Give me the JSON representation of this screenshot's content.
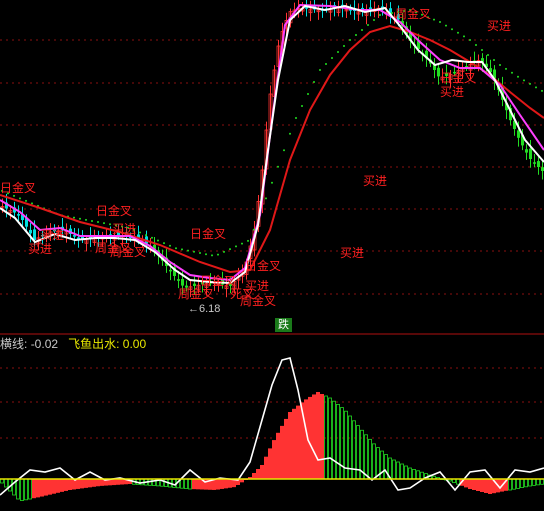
{
  "indicator": {
    "line_label": "横线:",
    "line_value": "-0.02",
    "flow_label": "飞鱼出水:",
    "flow_value": "0.00"
  },
  "badge_text": "跌",
  "colors": {
    "up": "#ff3333",
    "down": "#00e0e0",
    "down_strong": "#22dd22",
    "ma_white": "#ffffff",
    "ma_magenta": "#ff40ff",
    "ma_red": "#e01818",
    "dots_green": "#20e020",
    "grid_red": "#8a1010",
    "label_red": "#ff2020",
    "yellow": "#e8e800"
  },
  "chart_data": [
    {
      "type": "candlestick",
      "title": "",
      "grid": true,
      "price_markers": [
        {
          "label": "6.18"
        }
      ],
      "signals": [
        {
          "text": "日金叉"
        },
        {
          "text": "日金叉"
        },
        {
          "text": "买进"
        },
        {
          "text": "买进"
        },
        {
          "text": "周金叉"
        },
        {
          "text": "买进"
        },
        {
          "text": "周金叉"
        },
        {
          "text": "日金叉"
        },
        {
          "text": "日金叉"
        },
        {
          "text": "周金叉"
        },
        {
          "text": "死叉"
        },
        {
          "text": "买进"
        },
        {
          "text": "周金叉"
        },
        {
          "text": "日金叉"
        },
        {
          "text": "买进"
        },
        {
          "text": "买进"
        },
        {
          "text": "日金叉"
        },
        {
          "text": "买进"
        },
        {
          "text": "周金叉"
        },
        {
          "text": "买进"
        }
      ]
    },
    {
      "type": "area",
      "title": "",
      "grid": true,
      "series": [
        {
          "name": "横线",
          "value": -0.02
        },
        {
          "name": "飞鱼出水",
          "value": 0.0
        }
      ]
    }
  ]
}
